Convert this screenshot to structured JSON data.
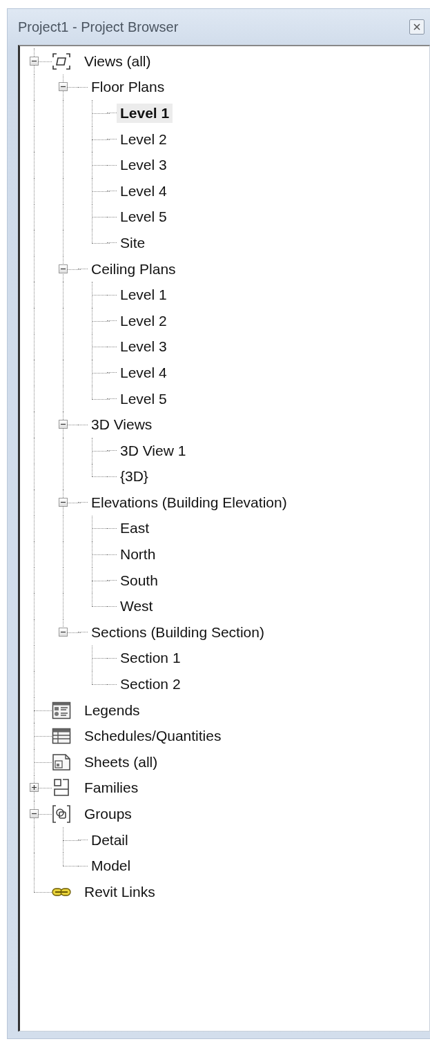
{
  "window": {
    "title": "Project1 - Project Browser"
  },
  "tree": [
    {
      "label": "Views (all)",
      "kind": "views",
      "expanded": true,
      "selected": false,
      "children": [
        {
          "label": "Floor Plans",
          "expanded": true,
          "selected": false,
          "children": [
            {
              "label": "Level 1",
              "selected": true
            },
            {
              "label": "Level 2",
              "selected": false
            },
            {
              "label": "Level 3",
              "selected": false
            },
            {
              "label": "Level 4",
              "selected": false
            },
            {
              "label": "Level 5",
              "selected": false
            },
            {
              "label": "Site",
              "selected": false
            }
          ]
        },
        {
          "label": "Ceiling Plans",
          "expanded": true,
          "selected": false,
          "children": [
            {
              "label": "Level 1",
              "selected": false
            },
            {
              "label": "Level 2",
              "selected": false
            },
            {
              "label": "Level 3",
              "selected": false
            },
            {
              "label": "Level 4",
              "selected": false
            },
            {
              "label": "Level 5",
              "selected": false
            }
          ]
        },
        {
          "label": "3D Views",
          "expanded": true,
          "selected": false,
          "children": [
            {
              "label": "3D View 1",
              "selected": false
            },
            {
              "label": "{3D}",
              "selected": false
            }
          ]
        },
        {
          "label": "Elevations (Building Elevation)",
          "expanded": true,
          "selected": false,
          "children": [
            {
              "label": "East",
              "selected": false
            },
            {
              "label": "North",
              "selected": false
            },
            {
              "label": "South",
              "selected": false
            },
            {
              "label": "West",
              "selected": false
            }
          ]
        },
        {
          "label": "Sections (Building Section)",
          "expanded": true,
          "selected": false,
          "children": [
            {
              "label": "Section 1",
              "selected": false
            },
            {
              "label": "Section 2",
              "selected": false
            }
          ]
        }
      ]
    },
    {
      "label": "Legends",
      "kind": "legends",
      "selected": false
    },
    {
      "label": "Schedules/Quantities",
      "kind": "schedules",
      "selected": false
    },
    {
      "label": "Sheets (all)",
      "kind": "sheets",
      "selected": false
    },
    {
      "label": "Families",
      "kind": "families",
      "expanded": false,
      "selected": false
    },
    {
      "label": "Groups",
      "kind": "groups",
      "expanded": true,
      "selected": false,
      "children": [
        {
          "label": "Detail",
          "selected": false
        },
        {
          "label": "Model",
          "selected": false
        }
      ]
    },
    {
      "label": "Revit Links",
      "kind": "links",
      "selected": false
    }
  ]
}
